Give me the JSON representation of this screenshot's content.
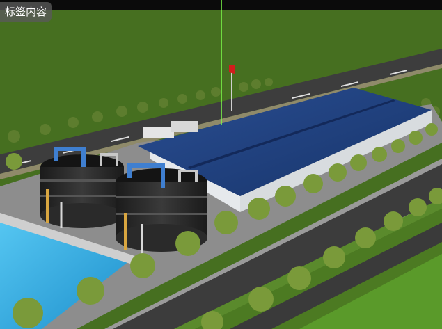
{
  "overlay": {
    "tag_label": "标签内容"
  },
  "colors": {
    "sky": "#0b0b0b",
    "grass": "#466f20",
    "grass_light": "#5a8a2c",
    "road": "#3c3c3c",
    "lane_mark": "#e8e8e8",
    "roof": "#1f3e7a",
    "wall": "#e9ecee",
    "tank": "#2a2a2a",
    "pipe_blue": "#3f7fd0",
    "pool_water": "#2aa6dc",
    "flag": "#d21c1c",
    "marker_line": "#7dff4a"
  },
  "scene": {
    "icons": [
      "flag-icon",
      "tree-icon",
      "tank-icon",
      "truck-icon"
    ]
  }
}
